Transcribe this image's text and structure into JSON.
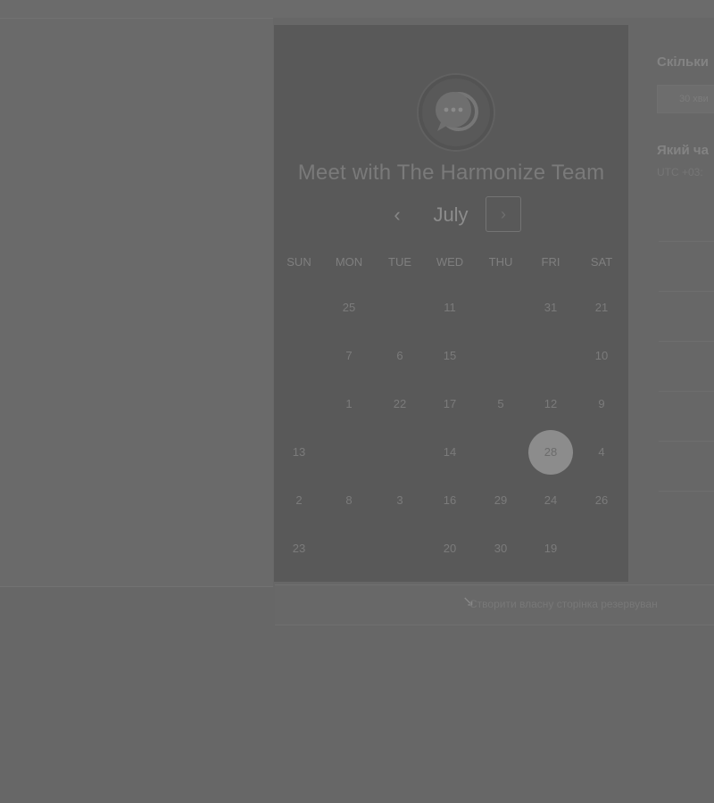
{
  "header": {
    "title": "Meet with The Harmonize Team"
  },
  "calendar": {
    "month": "July",
    "prev_icon": "‹",
    "next_icon": "›",
    "weekdays": [
      "SUN",
      "MON",
      "TUE",
      "WED",
      "THU",
      "FRI",
      "SAT"
    ],
    "rows": [
      [
        "",
        "25",
        "",
        "11",
        "",
        "31",
        "21"
      ],
      [
        "",
        "7",
        "6",
        "15",
        "",
        "",
        "10"
      ],
      [
        "",
        "1",
        "22",
        "17",
        "5",
        "12",
        "9"
      ],
      [
        "13",
        "",
        "",
        "14",
        "",
        "28",
        "4"
      ],
      [
        "2",
        "8",
        "3",
        "16",
        "29",
        "24",
        "26"
      ],
      [
        "23",
        "",
        "",
        "20",
        "30",
        "19",
        ""
      ]
    ],
    "selected": "28"
  },
  "right_panel": {
    "question_duration": "Скільки",
    "duration_value": "30 хви",
    "question_time": "Який ча",
    "timezone": "UTC +03:"
  },
  "footer": {
    "create_link": "Створити власну сторінка резервуван"
  },
  "colors": {
    "overlay": "#676767",
    "panel": "#595959",
    "selected": "#8c8c8c"
  }
}
